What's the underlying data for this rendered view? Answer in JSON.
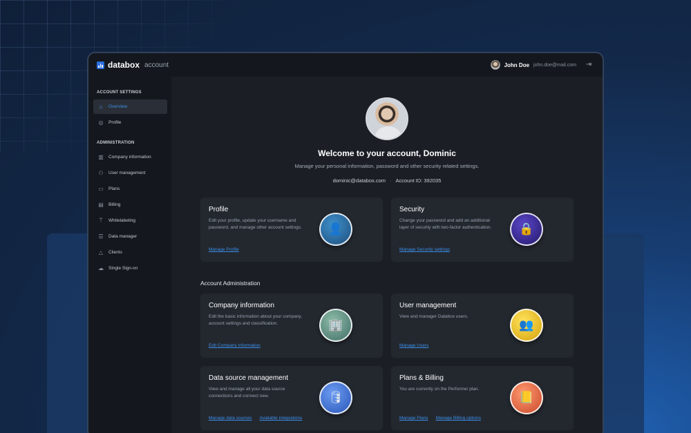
{
  "brand": {
    "name": "databox",
    "sub": "account"
  },
  "user": {
    "name": "John Doe",
    "email": "john.doe@mail.com"
  },
  "sidebar": {
    "settings_title": "ACCOUNT SETTINGS",
    "settings_items": [
      {
        "label": "Overview",
        "icon": "home-icon",
        "active": true
      },
      {
        "label": "Profile",
        "icon": "user-circle-icon",
        "active": false
      }
    ],
    "admin_title": "ADMINISTRATION",
    "admin_items": [
      {
        "label": "Company information",
        "icon": "building-icon"
      },
      {
        "label": "User management",
        "icon": "users-icon"
      },
      {
        "label": "Plans",
        "icon": "card-icon"
      },
      {
        "label": "Billing",
        "icon": "billing-icon"
      },
      {
        "label": "Whitelabeling",
        "icon": "paint-roller-icon"
      },
      {
        "label": "Data manager",
        "icon": "database-icon"
      },
      {
        "label": "Clients",
        "icon": "clients-icon"
      },
      {
        "label": "Single Sign-on",
        "icon": "cloud-icon"
      }
    ]
  },
  "header": {
    "welcome": "Welcome to your account, Dominic",
    "subtitle": "Manage your personal information, password and other security related settings.",
    "email": "dominic@databox.com",
    "account_id": "Account ID: 392035"
  },
  "top_cards": [
    {
      "title": "Profile",
      "desc": "Edit your profile, update your username and password, and manage other account settings.",
      "links": [
        "Manage Profile"
      ],
      "icon": "user-icon",
      "color": "#2c6ea6"
    },
    {
      "title": "Security",
      "desc": "Change your password and add an additional layer of security with two-factor authentication.",
      "links": [
        "Manage Security settings"
      ],
      "icon": "lock-icon",
      "color": "#3e2f9e"
    }
  ],
  "admin_section_title": "Account Administration",
  "admin_cards": [
    {
      "title": "Company information",
      "desc": "Edit the basic information about your company, account settings and classification.",
      "links": [
        "Edit Company information"
      ],
      "icon": "building-icon",
      "color": "#5f9486"
    },
    {
      "title": "User management",
      "desc": "View and manager Databox users.",
      "links": [
        "Manage Users"
      ],
      "icon": "users-icon",
      "color": "#e9c21e"
    },
    {
      "title": "Data source management",
      "desc": "View and manage all your data source connections and connect new.",
      "links": [
        "Manage data sources",
        "Available integrations"
      ],
      "icon": "database-icon",
      "color": "#3f77e0"
    },
    {
      "title": "Plans & Billing",
      "desc": "You are currently on the Performer plan.",
      "links": [
        "Manage Plans",
        "Manage Billing options"
      ],
      "icon": "billing-icon",
      "color": "#e57047"
    }
  ]
}
